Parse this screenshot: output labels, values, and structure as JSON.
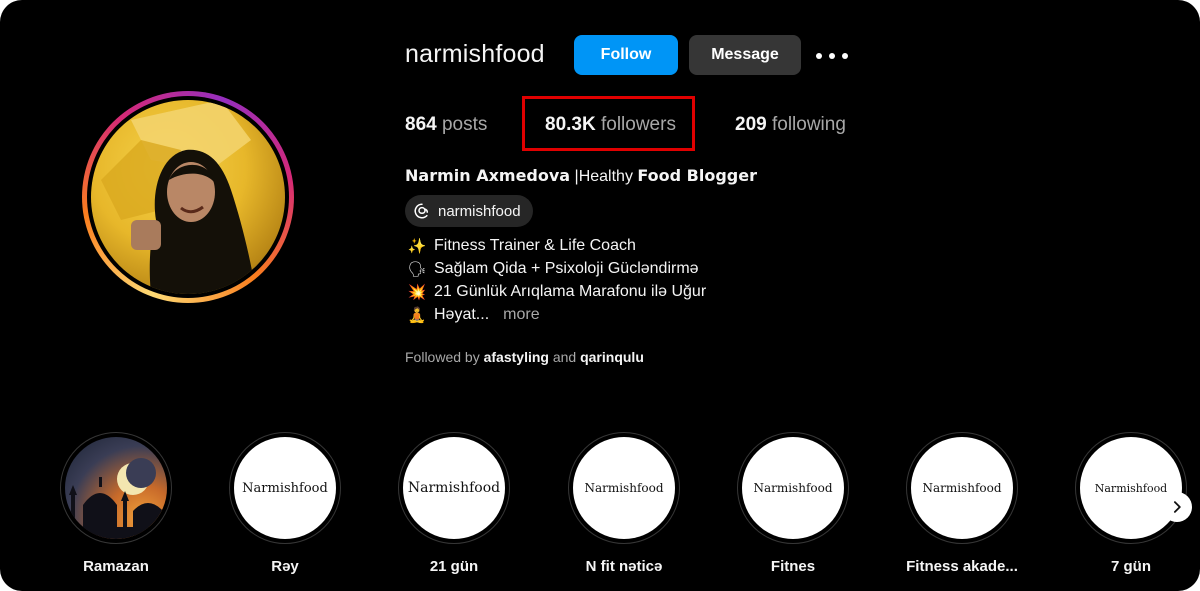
{
  "profile": {
    "username": "narmishfood",
    "follow_label": "Follow",
    "message_label": "Message",
    "more_options_icon": "ellipsis-horizontal-icon"
  },
  "stats": {
    "posts_count": "864",
    "posts_label": "posts",
    "followers_count": "80.3K",
    "followers_label": "followers",
    "following_count": "209",
    "following_label": "following"
  },
  "bio": {
    "name_bold": "Narmin Axmedova",
    "name_sep": " |Healthy ",
    "name_tail": "Food Blogger",
    "threads_handle": "narmishfood",
    "lines": [
      {
        "emoji": "✨",
        "text": "Fitness Trainer & Life Coach"
      },
      {
        "emoji": "🗣",
        "text": "Sağlam Qida + Psixoloji Gücləndirmə"
      },
      {
        "emoji": "💥",
        "text": "21 Günlük Arıqlama Marafonu ilə Uğur"
      },
      {
        "emoji": "🧘",
        "text": "Həyat..."
      }
    ],
    "more_label": "more",
    "followed_by_prefix": "Followed by",
    "followed_by_user1": "afastyling",
    "followed_by_and": "and",
    "followed_by_user2": "qarinqulu"
  },
  "highlights": [
    {
      "label": "Ramazan",
      "cover_text": ""
    },
    {
      "label": "Rəy",
      "cover_text": "Narmishfood"
    },
    {
      "label": "21 gün",
      "cover_text": "Narmishfood"
    },
    {
      "label": "N fit nəticə",
      "cover_text": "Narmishfood"
    },
    {
      "label": "Fitnes",
      "cover_text": "Narmishfood"
    },
    {
      "label": "Fitness akade...",
      "cover_text": "Narmishfood"
    },
    {
      "label": "7 gün",
      "cover_text": "Narmishfood"
    }
  ],
  "colors": {
    "background": "#000000",
    "follow_button": "#0095f6",
    "message_button": "#363636",
    "highlight_box": "#e00000"
  }
}
